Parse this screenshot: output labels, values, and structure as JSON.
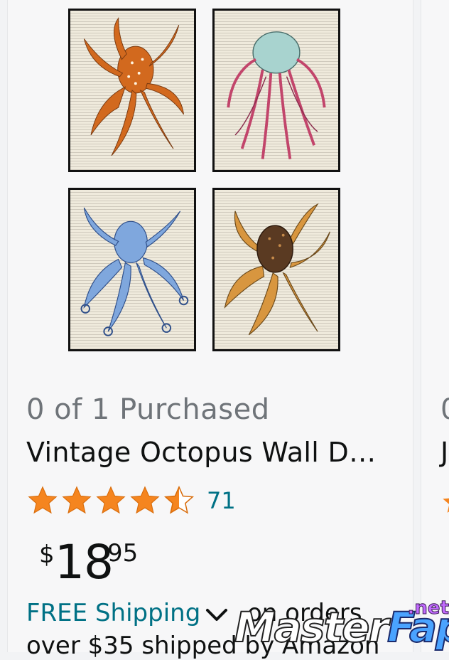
{
  "product": {
    "purchased_status": "0 of 1 Purchased",
    "title": "Vintage Octopus Wall D…",
    "rating_value": 4.5,
    "review_count": "71",
    "price": {
      "currency": "$",
      "whole": "18",
      "fraction": "95"
    },
    "shipping": {
      "link_text": "FREE Shipping",
      "rest_text": "on orders",
      "second_line": "over $35 shipped by Amazon"
    },
    "images": [
      {
        "icon": "orange-octopus-print"
      },
      {
        "icon": "pink-jellyfish-print"
      },
      {
        "icon": "blue-octopus-print"
      },
      {
        "icon": "brown-octopus-print"
      }
    ]
  },
  "next_card": {
    "purchased_status_fragment": "0",
    "title_fragment": "J"
  },
  "watermark": {
    "main": "Master",
    "accent": "Fap",
    "suffix": ".net"
  },
  "colors": {
    "link": "#007185",
    "star": "#f5851f",
    "text": "#0f1111",
    "muted": "#6f7479"
  }
}
